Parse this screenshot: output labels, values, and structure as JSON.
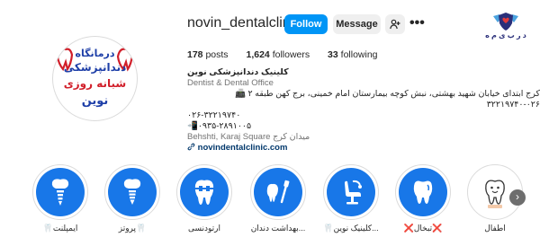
{
  "brand": {
    "text": "د ر ب ی م ه",
    "icon": "shield-heart-logo"
  },
  "profile": {
    "username": "novin_dentalclinic",
    "follow_label": "Follow",
    "message_label": "Message",
    "suggest_icon": "person-plus-icon",
    "more_icon": "ellipsis-icon",
    "avatar": {
      "line1": "درمانگاه",
      "line2": "دندانپزشکی",
      "line3": "شبانه روزی",
      "line4": "نوین"
    }
  },
  "stats": {
    "posts_count": "178",
    "posts_label": "posts",
    "followers_count": "1,624",
    "followers_label": "followers",
    "following_count": "33",
    "following_label": "following"
  },
  "bio": {
    "name": "کلینیک دندانپزشکی نوین",
    "category": "Dentist & Dental Office",
    "address": "کرج ابتدای خیابان شهید بهشتی، نبش کوچه بیمارستان امام خمینی، برج کهن طبقه ۲ 📠۰۲۶-۳۲۲۱۹۷۴۰",
    "phone": "۰۲۶-۳۲۲۱۹۷۴۰",
    "mobile": "📲۰۹۳۵-۲۸۹۱۰۰۵",
    "location": "Behshti, Karaj Square میدان کرج",
    "link": "novindentalclinic.com",
    "link_icon": "link-icon"
  },
  "highlights": [
    {
      "label": "🦷ایمپلنت",
      "icon": "implant-icon"
    },
    {
      "label": "پروتز🦷",
      "icon": "prosthesis-icon"
    },
    {
      "label": "ارتودنسی",
      "icon": "braces-tooth-icon"
    },
    {
      "label": "بهداشت دندان...",
      "icon": "toothbrush-icon"
    },
    {
      "label": "🦷کلینیک نوین...",
      "icon": "dental-chair-icon"
    },
    {
      "label": "❌تبخال❌",
      "icon": "tooth-icon"
    },
    {
      "label": "اطفال",
      "icon": "kid-tooth-icon"
    }
  ],
  "colors": {
    "accent": "#0095f6",
    "highlight_bg": "#1877e8",
    "link": "#00376b"
  }
}
